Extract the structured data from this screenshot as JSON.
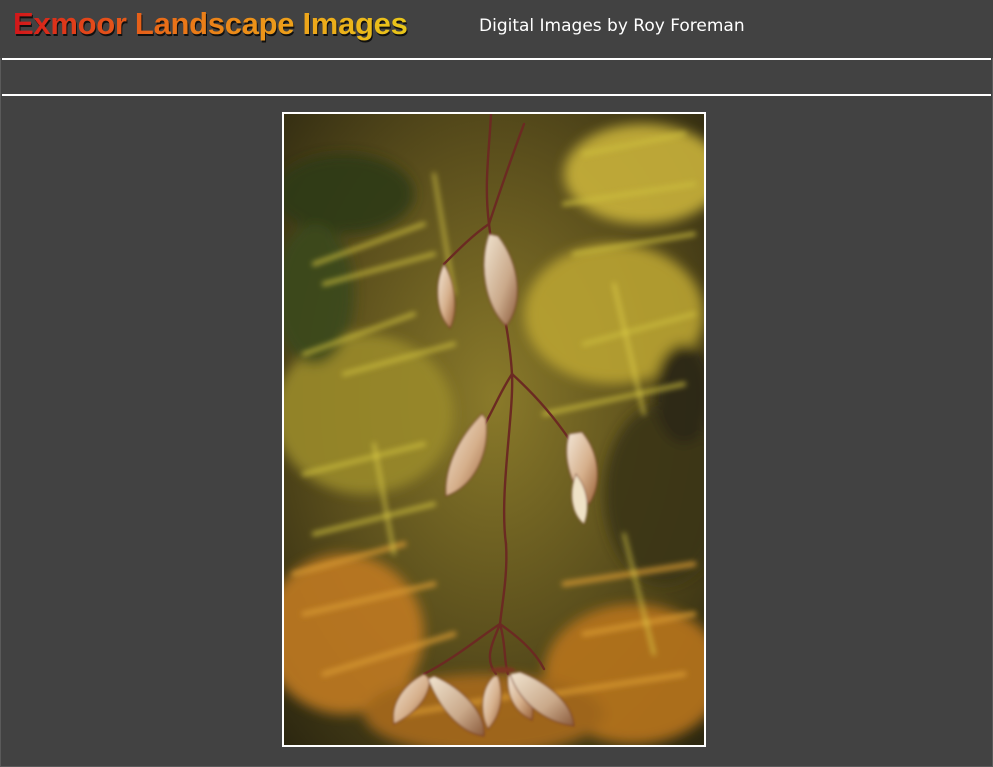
{
  "header": {
    "title": "Exmoor Landscape Images",
    "subtitle": "Digital Images by Roy Foreman"
  },
  "navbar": {
    "items": []
  },
  "photo": {
    "subject": "maple-seeds-autumn",
    "colors": {
      "background": "#424242",
      "foliage_yellow": "#d9c23a",
      "foliage_orange": "#d88a2a",
      "stem": "#6b2a22"
    }
  }
}
